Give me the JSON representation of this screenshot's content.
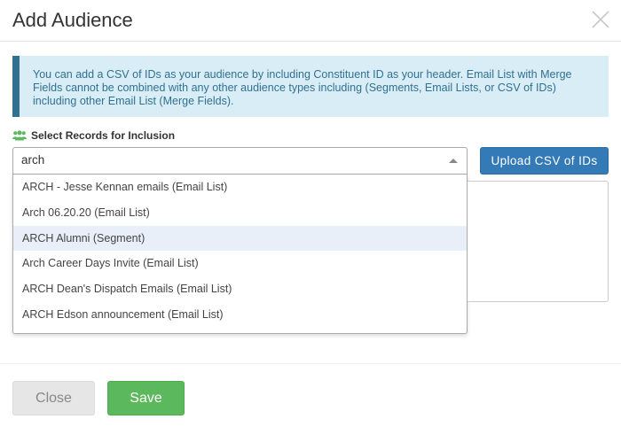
{
  "dialog": {
    "title": "Add Audience",
    "close_icon": "close-icon"
  },
  "info": {
    "text": "You can add a CSV of IDs as your audience by including Constituent ID as your header. Email List with Merge Fields cannot be combined with any other audience types including (Segments, Email Lists, or CSV of IDs) including other Email List (Merge Fields)."
  },
  "records": {
    "label": "Select Records for Inclusion",
    "icon": "users-icon",
    "icon_color": "#5cb85c",
    "search_value": "arch",
    "options": [
      {
        "label": "ARCH - Jesse Kennan emails (Email List)",
        "highlighted": false
      },
      {
        "label": "Arch 06.20.20 (Email List)",
        "highlighted": false
      },
      {
        "label": "ARCH Alumni (Segment)",
        "highlighted": true
      },
      {
        "label": "Arch Career Days Invite (Email List)",
        "highlighted": false
      },
      {
        "label": "ARCH Dean's Dispatch Emails (Email List)",
        "highlighted": false
      },
      {
        "label": "ARCH Edson announcement (Email List)",
        "highlighted": false
      }
    ]
  },
  "upload": {
    "label": "Upload CSV of IDs"
  },
  "footer": {
    "close_label": "Close",
    "save_label": "Save"
  },
  "colors": {
    "primary": "#337ab7",
    "success": "#5cb85c",
    "info_bg": "#d9edf7",
    "info_text": "#31708f",
    "highlight": "#e8eff9"
  }
}
